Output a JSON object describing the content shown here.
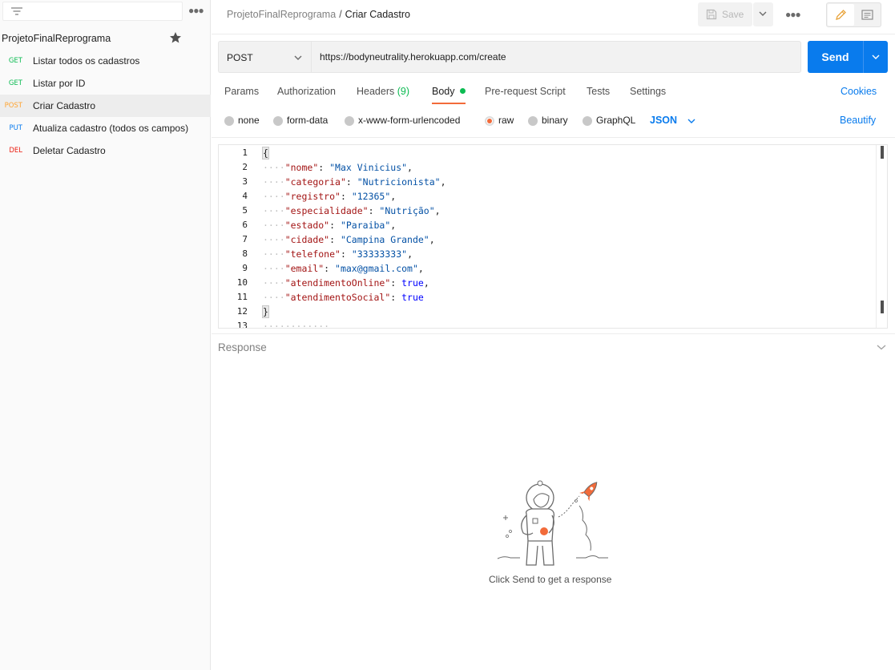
{
  "sidebar": {
    "collection_name": "ProjetoFinalReprograma",
    "items": [
      {
        "method": "GET",
        "label": "Listar todos os cadastros",
        "active": false
      },
      {
        "method": "GET",
        "label": "Listar por ID",
        "active": false
      },
      {
        "method": "POST",
        "label": "Criar Cadastro",
        "active": true
      },
      {
        "method": "PUT",
        "label": "Atualiza cadastro (todos os campos)",
        "active": false
      },
      {
        "method": "DEL",
        "label": "Deletar Cadastro",
        "active": false
      }
    ]
  },
  "header": {
    "breadcrumb_parent": "ProjetoFinalReprograma",
    "breadcrumb_separator": "/",
    "breadcrumb_current": "Criar Cadastro",
    "save_label": "Save"
  },
  "request": {
    "method": "POST",
    "url": "https://bodyneutrality.herokuapp.com/create",
    "send_label": "Send"
  },
  "tabs": [
    {
      "label": "Params"
    },
    {
      "label": "Authorization"
    },
    {
      "label": "Headers",
      "count": "(9)"
    },
    {
      "label": "Body",
      "active": true
    },
    {
      "label": "Pre-request Script"
    },
    {
      "label": "Tests"
    },
    {
      "label": "Settings"
    }
  ],
  "cookies_label": "Cookies",
  "body_types": [
    {
      "label": "none",
      "selected": false
    },
    {
      "label": "form-data",
      "selected": false
    },
    {
      "label": "x-www-form-urlencoded",
      "selected": false
    },
    {
      "label": "raw",
      "selected": true
    },
    {
      "label": "binary",
      "selected": false
    },
    {
      "label": "GraphQL",
      "selected": false
    }
  ],
  "body_format": "JSON",
  "beautify_label": "Beautify",
  "editor": {
    "line_numbers": [
      "1",
      "2",
      "3",
      "4",
      "5",
      "6",
      "7",
      "8",
      "9",
      "10",
      "11",
      "12",
      "13"
    ],
    "fields": [
      {
        "key": "\"nome\"",
        "value": "\"Max Vinicius\"",
        "kind": "string"
      },
      {
        "key": "\"categoria\"",
        "value": "\"Nutricionista\"",
        "kind": "string"
      },
      {
        "key": "\"registro\"",
        "value": "\"12365\"",
        "kind": "string"
      },
      {
        "key": "\"especialidade\"",
        "value": "\"Nutrição\"",
        "kind": "string"
      },
      {
        "key": "\"estado\"",
        "value": "\"Paraiba\"",
        "kind": "string"
      },
      {
        "key": "\"cidade\"",
        "value": "\"Campina Grande\"",
        "kind": "string"
      },
      {
        "key": "\"telefone\"",
        "value": "\"33333333\"",
        "kind": "string"
      },
      {
        "key": "\"email\"",
        "value": "\"max@gmail.com\"",
        "kind": "string"
      },
      {
        "key": "\"atendimentoOnline\"",
        "value": "true",
        "kind": "bool"
      },
      {
        "key": "\"atendimentoSocial\"",
        "value": "true",
        "kind": "bool"
      }
    ],
    "open_brace": "{",
    "close_brace": "}"
  },
  "response": {
    "label": "Response",
    "empty_message": "Click Send to get a response"
  },
  "colors": {
    "accent_blue": "#097bed",
    "accent_orange": "#f26b3a",
    "get_green": "#0cbb52",
    "post_orange": "#ffa533",
    "put_blue": "#097bed",
    "del_red": "#eb2013"
  },
  "icons": [
    "filter-icon",
    "more-icon",
    "star-icon",
    "save-icon",
    "chevron-down-icon",
    "pencil-icon",
    "document-icon",
    "astronaut-illustration"
  ]
}
